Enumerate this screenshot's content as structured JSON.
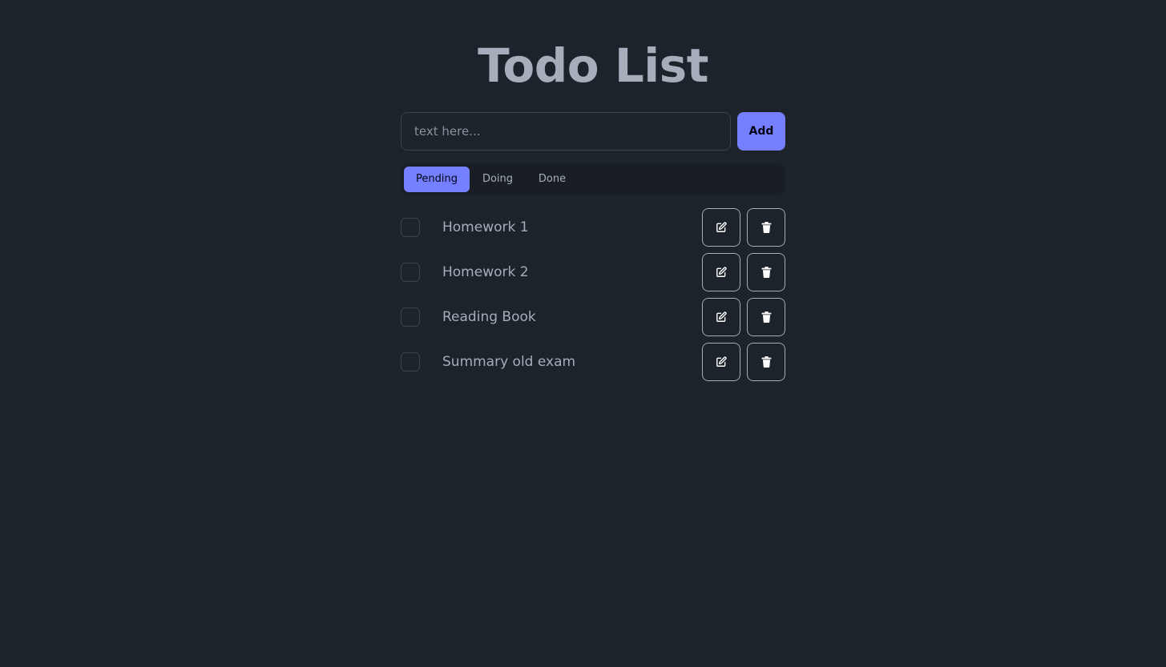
{
  "header": {
    "title": "Todo List"
  },
  "new_todo": {
    "value": "",
    "placeholder": "text here...",
    "add_label": "Add"
  },
  "tabs": [
    {
      "label": "Pending",
      "active": true
    },
    {
      "label": "Doing",
      "active": false
    },
    {
      "label": "Done",
      "active": false
    }
  ],
  "todos": [
    {
      "text": "Homework 1",
      "checked": false
    },
    {
      "text": "Homework 2",
      "checked": false
    },
    {
      "text": "Reading Book",
      "checked": false
    },
    {
      "text": "Summary old exam",
      "checked": false
    }
  ],
  "icons": {
    "edit": "edit-icon",
    "delete": "trash-icon"
  },
  "colors": {
    "background": "#1d232a",
    "accent": "#7480ff",
    "text": "#a6adbb",
    "tabs_background": "#191e24"
  }
}
